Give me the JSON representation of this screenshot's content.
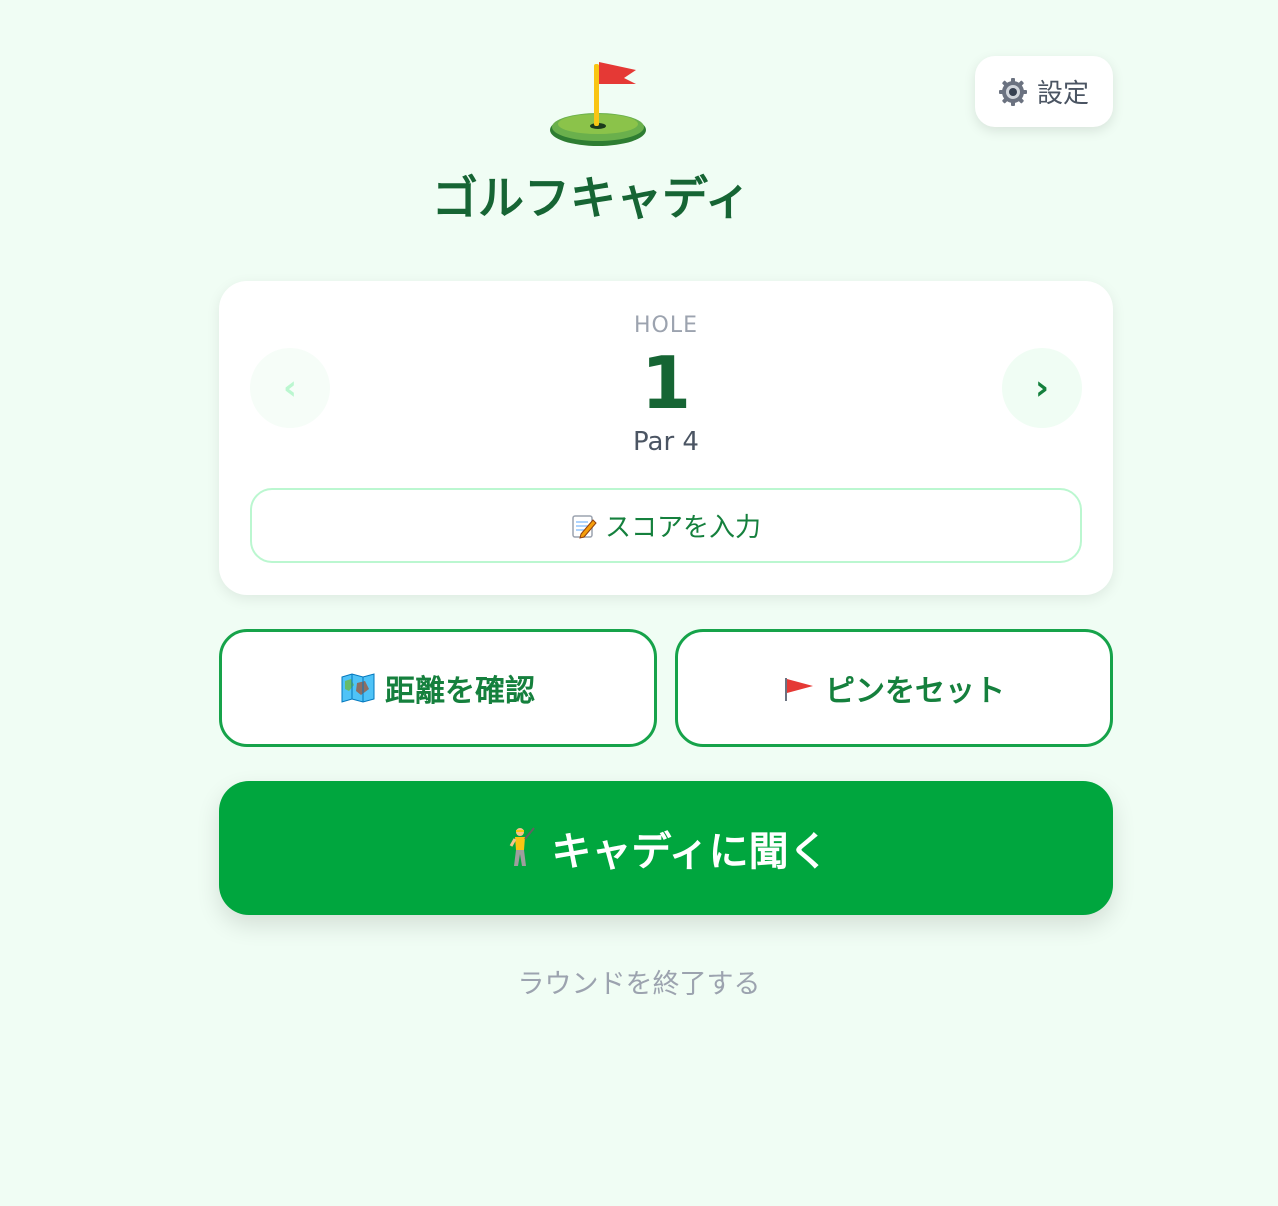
{
  "header": {
    "app_title": "ゴルフキャディ",
    "logo_icon": "flag-in-hole-icon",
    "settings_label": "設定",
    "settings_icon": "gear-icon"
  },
  "hole_card": {
    "label": "HOLE",
    "number": "1",
    "par_text": "Par 4",
    "prev_label": "‹",
    "next_label": "›",
    "score_button_label": "スコアを入力",
    "score_button_icon": "memo-icon"
  },
  "actions": {
    "distance_label": "距離を確認",
    "distance_icon": "map-icon",
    "pin_label": "ピンをセット",
    "pin_icon": "red-flag-icon",
    "caddie_label": "キャディに聞く",
    "caddie_icon": "golfer-icon"
  },
  "footer": {
    "end_round_label": "ラウンドを終了する"
  },
  "colors": {
    "background": "#f0fdf4",
    "primary_green": "#00a63e",
    "dark_green": "#166534",
    "text_green": "#15803d",
    "muted_gray": "#9ca3af"
  }
}
